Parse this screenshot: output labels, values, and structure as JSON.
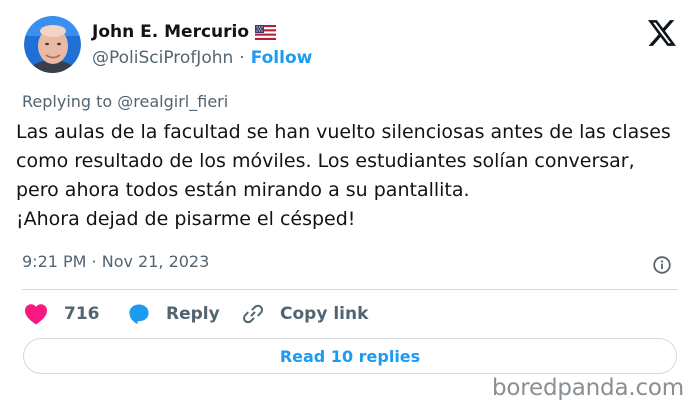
{
  "author": {
    "name": "John E. Mercurio",
    "flag_icon": "us-flag-icon",
    "handle": "@PoliSciProfJohn",
    "separator": "·",
    "follow_label": "Follow"
  },
  "platform_icon": "x-logo-icon",
  "reply_to": "Replying to @realgirl_fieri",
  "tweet_lines": [
    "Las aulas de la facultad se han vuelto silenciosas antes de las clases",
    "como resultado de los móviles. Los estudiantes solían conversar,",
    "pero ahora todos están mirando a su pantallita.",
    "¡Ahora dejad de pisarme el césped!"
  ],
  "timestamp": "9:21 PM · Nov 21, 2023",
  "actions": {
    "like_count": "716",
    "reply_label": "Reply",
    "copy_link_label": "Copy link"
  },
  "read_replies_label": "Read 10 replies",
  "watermark": "boredpanda.com",
  "colors": {
    "accent": "#1d9bf0",
    "heart": "#f91880",
    "muted": "#536471",
    "text": "#0f1419",
    "border": "#cfd9de"
  }
}
